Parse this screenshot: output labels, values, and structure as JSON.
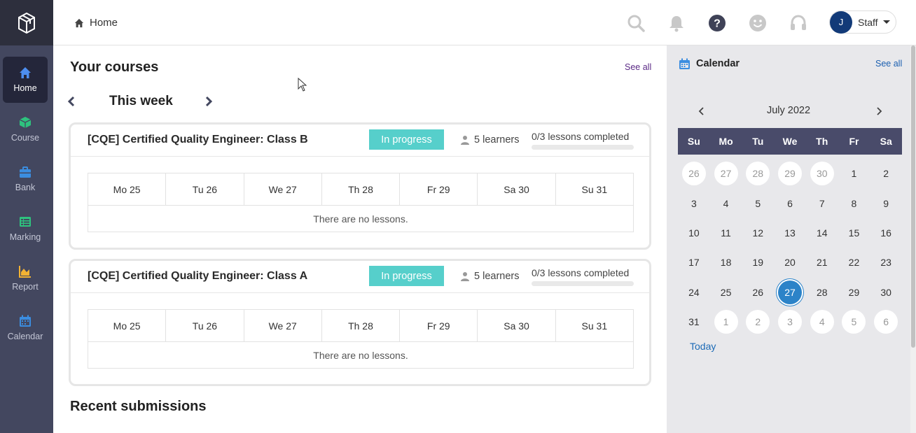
{
  "nav": {
    "items": [
      {
        "label": "Home",
        "icon": "home-icon",
        "color": "#4d8ef0",
        "active": true
      },
      {
        "label": "Course",
        "icon": "cube-icon",
        "color": "#2ec27e",
        "active": false
      },
      {
        "label": "Bank",
        "icon": "toolbox-icon",
        "color": "#3b8de0",
        "active": false
      },
      {
        "label": "Marking",
        "icon": "marking-icon",
        "color": "#2ec27e",
        "active": false
      },
      {
        "label": "Report",
        "icon": "area-chart-icon",
        "color": "#f2b233",
        "active": false
      },
      {
        "label": "Calendar",
        "icon": "calendar-icon",
        "color": "#3b8de0",
        "active": false
      }
    ]
  },
  "header": {
    "breadcrumb": "Home",
    "user_initial": "J",
    "user_label": "Staff"
  },
  "main": {
    "courses_title": "Your courses",
    "see_all": "See all",
    "week_title": "This week",
    "courses": [
      {
        "title": "[CQE] Certified Quality Engineer: Class B",
        "status": "In progress",
        "learners": "5 learners",
        "progress_label": "0/3 lessons completed",
        "progress": 0,
        "days": [
          "Mo 25",
          "Tu 26",
          "We 27",
          "Th 28",
          "Fr 29",
          "Sa 30",
          "Su 31"
        ],
        "empty": "There are no lessons."
      },
      {
        "title": "[CQE] Certified Quality Engineer: Class A",
        "status": "In progress",
        "learners": "5 learners",
        "progress_label": "0/3 lessons completed",
        "progress": 0,
        "days": [
          "Mo 25",
          "Tu 26",
          "We 27",
          "Th 28",
          "Fr 29",
          "Sa 30",
          "Su 31"
        ],
        "empty": "There are no lessons."
      }
    ],
    "submissions_title": "Recent submissions"
  },
  "calendar": {
    "title": "Calendar",
    "see_all": "See all",
    "month": "July 2022",
    "weekdays": [
      "Su",
      "Mo",
      "Tu",
      "We",
      "Th",
      "Fr",
      "Sa"
    ],
    "weeks": [
      [
        {
          "d": "26",
          "o": true
        },
        {
          "d": "27",
          "o": true
        },
        {
          "d": "28",
          "o": true
        },
        {
          "d": "29",
          "o": true
        },
        {
          "d": "30",
          "o": true
        },
        {
          "d": "1"
        },
        {
          "d": "2"
        }
      ],
      [
        {
          "d": "3"
        },
        {
          "d": "4"
        },
        {
          "d": "5"
        },
        {
          "d": "6"
        },
        {
          "d": "7"
        },
        {
          "d": "8"
        },
        {
          "d": "9"
        }
      ],
      [
        {
          "d": "10"
        },
        {
          "d": "11"
        },
        {
          "d": "12"
        },
        {
          "d": "13"
        },
        {
          "d": "14"
        },
        {
          "d": "15"
        },
        {
          "d": "16"
        }
      ],
      [
        {
          "d": "17"
        },
        {
          "d": "18"
        },
        {
          "d": "19"
        },
        {
          "d": "20"
        },
        {
          "d": "21"
        },
        {
          "d": "22"
        },
        {
          "d": "23"
        }
      ],
      [
        {
          "d": "24"
        },
        {
          "d": "25"
        },
        {
          "d": "26"
        },
        {
          "d": "27",
          "t": true
        },
        {
          "d": "28"
        },
        {
          "d": "29"
        },
        {
          "d": "30"
        }
      ],
      [
        {
          "d": "31"
        },
        {
          "d": "1",
          "o": true
        },
        {
          "d": "2",
          "o": true
        },
        {
          "d": "3",
          "o": true
        },
        {
          "d": "4",
          "o": true
        },
        {
          "d": "5",
          "o": true
        },
        {
          "d": "6",
          "o": true
        }
      ]
    ],
    "today_label": "Today"
  }
}
